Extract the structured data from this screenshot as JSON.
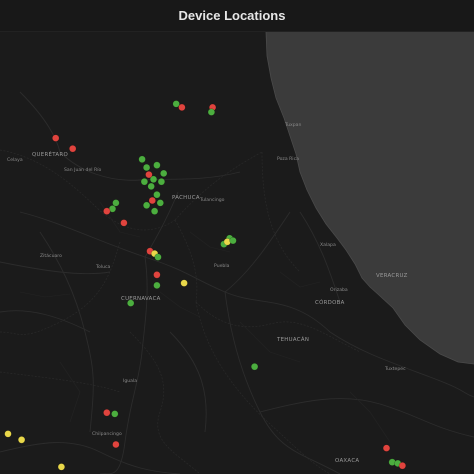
{
  "panel": {
    "title": "Device Locations"
  },
  "map": {
    "colors": {
      "land": "#1b1b1b",
      "sea": "#3b3b3b",
      "roads": "#2b2b2b",
      "marker_green": "#4cae3f",
      "marker_red": "#e0443e",
      "marker_yellow": "#e9d84a"
    },
    "places": {
      "queretaro": "QUERÉTARO",
      "cuernavaca": "CUERNAVACA",
      "veracruz": "VERACRUZ",
      "cordoba": "CÓRDOBA",
      "tehuacan": "TEHUACÁN",
      "tuxpan": "Tuxpan",
      "poza_rica": "Poza Rica",
      "xalapa": "Xalapa",
      "puebla": "Puebla",
      "pachuca": "PACHUCA",
      "tulancingo": "Tulancingo",
      "toluca": "Toluca",
      "zitacuaro": "Zitácuaro",
      "celaya": "Celaya",
      "san_juan_del_rio": "San Juan del Río",
      "iguala": "Iguala",
      "chilpancingo": "Chilpancingo",
      "orizaba": "Orizaba",
      "tuxtepec": "Tuxtepec",
      "oaxaca": "OAXACA"
    },
    "markers": [
      {
        "status": "green",
        "lon": -98.67,
        "lat": 20.24
      },
      {
        "status": "red",
        "lon": -98.62,
        "lat": 20.21
      },
      {
        "status": "red",
        "lon": -98.35,
        "lat": 20.21
      },
      {
        "status": "green",
        "lon": -98.36,
        "lat": 20.17
      },
      {
        "status": "red",
        "lon": -99.73,
        "lat": 19.95
      },
      {
        "status": "red",
        "lon": -99.58,
        "lat": 19.86
      },
      {
        "status": "green",
        "lon": -98.97,
        "lat": 19.77
      },
      {
        "status": "green",
        "lon": -98.93,
        "lat": 19.7
      },
      {
        "status": "green",
        "lon": -98.84,
        "lat": 19.72
      },
      {
        "status": "green",
        "lon": -98.87,
        "lat": 19.6
      },
      {
        "status": "green",
        "lon": -98.95,
        "lat": 19.58
      },
      {
        "status": "red",
        "lon": -98.91,
        "lat": 19.64
      },
      {
        "status": "green",
        "lon": -98.89,
        "lat": 19.54
      },
      {
        "status": "green",
        "lon": -98.84,
        "lat": 19.47
      },
      {
        "status": "red",
        "lon": -98.88,
        "lat": 19.42
      },
      {
        "status": "green",
        "lon": -98.93,
        "lat": 19.38
      },
      {
        "status": "green",
        "lon": -98.86,
        "lat": 19.33
      },
      {
        "status": "green",
        "lon": -98.81,
        "lat": 19.4
      },
      {
        "status": "green",
        "lon": -98.8,
        "lat": 19.58
      },
      {
        "status": "green",
        "lon": -98.78,
        "lat": 19.65
      },
      {
        "status": "green",
        "lon": -99.23,
        "lat": 19.35
      },
      {
        "status": "red",
        "lon": -99.28,
        "lat": 19.33
      },
      {
        "status": "green",
        "lon": -99.2,
        "lat": 19.4
      },
      {
        "status": "red",
        "lon": -99.13,
        "lat": 19.23
      },
      {
        "status": "green",
        "lon": -98.25,
        "lat": 19.05
      },
      {
        "status": "green",
        "lon": -98.2,
        "lat": 19.1
      },
      {
        "status": "yellow",
        "lon": -98.22,
        "lat": 19.07
      },
      {
        "status": "green",
        "lon": -98.17,
        "lat": 19.08
      },
      {
        "status": "red",
        "lon": -98.9,
        "lat": 18.99
      },
      {
        "status": "yellow",
        "lon": -98.86,
        "lat": 18.97
      },
      {
        "status": "green",
        "lon": -98.83,
        "lat": 18.94
      },
      {
        "status": "red",
        "lon": -98.84,
        "lat": 18.79
      },
      {
        "status": "green",
        "lon": -98.84,
        "lat": 18.7
      },
      {
        "status": "yellow",
        "lon": -98.6,
        "lat": 18.72
      },
      {
        "status": "green",
        "lon": -99.07,
        "lat": 18.55
      },
      {
        "status": "green",
        "lon": -97.98,
        "lat": 18.01
      },
      {
        "status": "red",
        "lon": -99.28,
        "lat": 17.62
      },
      {
        "status": "green",
        "lon": -99.21,
        "lat": 17.61
      },
      {
        "status": "yellow",
        "lon": -100.15,
        "lat": 17.44
      },
      {
        "status": "yellow",
        "lon": -100.03,
        "lat": 17.39
      },
      {
        "status": "red",
        "lon": -99.2,
        "lat": 17.35
      },
      {
        "status": "yellow",
        "lon": -99.68,
        "lat": 17.16
      },
      {
        "status": "red",
        "lon": -96.82,
        "lat": 17.32
      },
      {
        "status": "green",
        "lon": -96.77,
        "lat": 17.2
      },
      {
        "status": "green",
        "lon": -96.72,
        "lat": 17.19
      },
      {
        "status": "red",
        "lon": -96.68,
        "lat": 17.17
      }
    ]
  }
}
